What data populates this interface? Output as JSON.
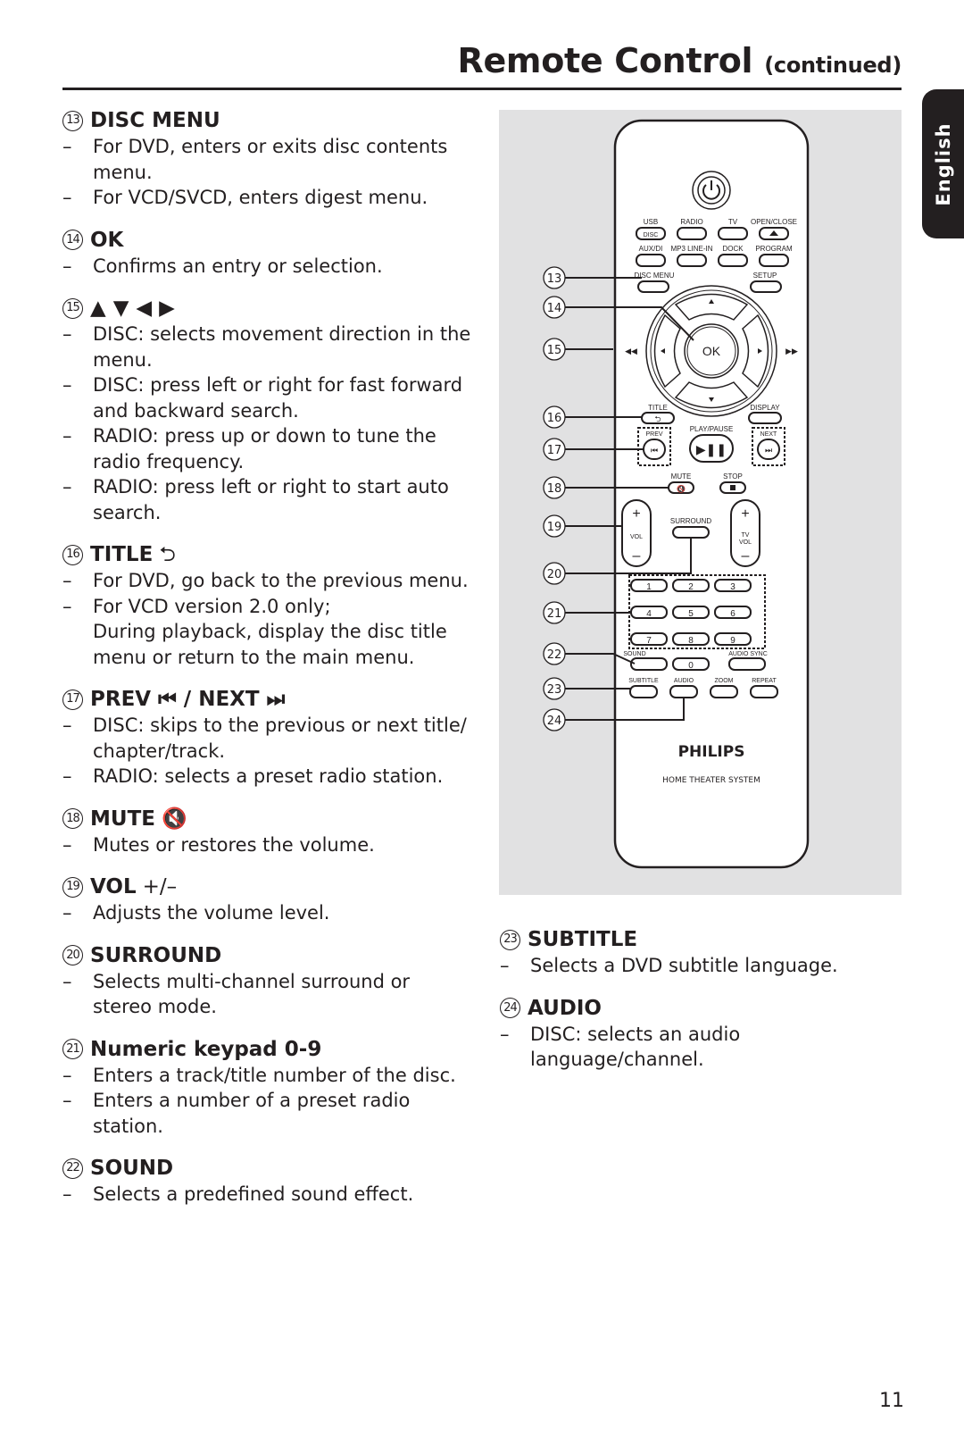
{
  "header": {
    "title": "Remote Control",
    "continued": "(continued)",
    "language_tab": "English"
  },
  "sections_left": [
    {
      "num": "13",
      "title": "DISC MENU",
      "extra": "",
      "bullets": [
        [
          "For DVD, enters or exits disc contents",
          "menu."
        ],
        [
          "For VCD/SVCD, enters digest menu."
        ]
      ]
    },
    {
      "num": "14",
      "title": "OK",
      "extra": "",
      "bullets": [
        [
          "Confirms an entry or selection."
        ]
      ]
    },
    {
      "num": "15",
      "title": "▲ ▼ ◀ ▶",
      "extra": "",
      "bullets": [
        [
          "DISC: selects movement direction in the",
          "menu."
        ],
        [
          "DISC: press left or right for fast forward",
          "and backward search."
        ],
        [
          "RADIO: press up or down to tune the",
          "radio frequency."
        ],
        [
          "RADIO: press left or right to start auto",
          "search."
        ]
      ]
    },
    {
      "num": "16",
      "title": "TITLE",
      "extra": "⮌",
      "bullets": [
        [
          "For DVD, go back to the previous menu."
        ],
        [
          "For VCD version 2.0 only;",
          "During playback, display the disc title",
          "menu or return to the main menu."
        ]
      ]
    },
    {
      "num": "17",
      "title": "PREV ⏮ / NEXT ⏭",
      "extra": "",
      "bullets": [
        [
          "DISC: skips to the previous or next title/",
          "chapter/track."
        ],
        [
          "RADIO: selects a preset radio station."
        ]
      ]
    },
    {
      "num": "18",
      "title": "MUTE",
      "extra": "🔇",
      "bullets": [
        [
          "Mutes or restores the volume."
        ]
      ]
    },
    {
      "num": "19",
      "title": "VOL",
      "extra": "+/–",
      "bullets": [
        [
          "Adjusts the volume level."
        ]
      ]
    },
    {
      "num": "20",
      "title": "SURROUND",
      "extra": "",
      "bullets": [
        [
          "Selects multi-channel surround or",
          "stereo mode."
        ]
      ]
    },
    {
      "num": "21",
      "title": "Numeric keypad 0-9",
      "extra": "",
      "bullets": [
        [
          "Enters a track/title number of the disc."
        ],
        [
          "Enters a number of a preset radio station."
        ]
      ]
    },
    {
      "num": "22",
      "title": "SOUND",
      "extra": "",
      "bullets": [
        [
          "Selects a predefined sound effect."
        ]
      ]
    }
  ],
  "sections_right": [
    {
      "num": "23",
      "title": "SUBTITLE",
      "extra": "",
      "bullets": [
        [
          "Selects a DVD subtitle language."
        ]
      ]
    },
    {
      "num": "24",
      "title": "AUDIO",
      "extra": "",
      "bullets": [
        [
          "DISC: selects an audio language/channel."
        ]
      ]
    }
  ],
  "remote": {
    "brand": "PHILIPS",
    "model_text": "HOME THEATER SYSTEM",
    "source_row1": [
      "USB",
      "RADIO",
      "TV",
      "OPEN/CLOSE"
    ],
    "disc_label": "DISC",
    "source_row2": [
      "AUX/DI",
      "MP3 LINE-IN",
      "DOCK",
      "PROGRAM"
    ],
    "menu_row": [
      "DISC MENU",
      "SETUP"
    ],
    "ok_label": "OK",
    "title_label": "TITLE",
    "display_label": "DISPLAY",
    "prev_label": "PREV",
    "play_pause_label": "PLAY/PAUSE",
    "next_label": "NEXT",
    "mute_label": "MUTE",
    "stop_label": "STOP",
    "vol_label": "VOL",
    "tv_vol_label": "TV VOL",
    "surround_label": "SURROUND",
    "keypad": [
      "1",
      "2",
      "3",
      "4",
      "5",
      "6",
      "7",
      "8",
      "9",
      "0"
    ],
    "sound_label": "SOUND",
    "audio_sync_label": "AUDIO SYNC",
    "bottom_row": [
      "SUBTITLE",
      "AUDIO",
      "ZOOM",
      "REPEAT"
    ],
    "callouts": [
      "13",
      "14",
      "15",
      "16",
      "17",
      "18",
      "19",
      "20",
      "21",
      "22",
      "23",
      "24"
    ]
  },
  "page_number": "11"
}
